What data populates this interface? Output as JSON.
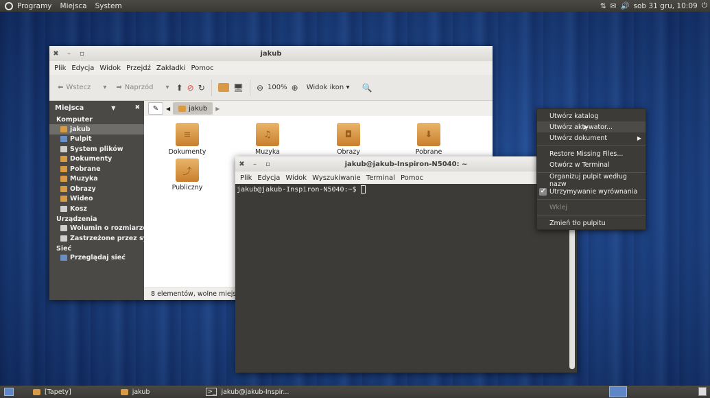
{
  "top_panel": {
    "menus": [
      "Programy",
      "Miejsca",
      "System"
    ],
    "clock": "sob 31 gru, 10:09"
  },
  "file_manager": {
    "title": "jakub",
    "menu": [
      "Plik",
      "Edycja",
      "Widok",
      "Przejdź",
      "Zakładki",
      "Pomoc"
    ],
    "toolbar": {
      "back_label": "Wstecz",
      "forward_label": "Naprzód",
      "zoom": "100%",
      "view_label": "Widok ikon"
    },
    "sidebar": {
      "title": "Miejsca",
      "sections": [
        {
          "heading": "Komputer",
          "items": [
            "jakub",
            "Pulpit",
            "System plików",
            "Dokumenty",
            "Pobrane",
            "Muzyka",
            "Obrazy",
            "Wideo",
            "Kosz"
          ]
        },
        {
          "heading": "Urządzenia",
          "items": [
            "Wolumin o rozmiarze ...",
            "Zastrzeżone przez sys..."
          ]
        },
        {
          "heading": "Sieć",
          "items": [
            "Przeglądaj sieć"
          ]
        }
      ]
    },
    "path_crumb": "jakub",
    "files": [
      "Dokumenty",
      "Muzyka",
      "Obrazy",
      "Pobrane",
      "Publiczny"
    ],
    "status": "8 elementów, wolne miejsce:"
  },
  "terminal": {
    "title": "jakub@jakub-Inspiron-N5040: ~",
    "menu": [
      "Plik",
      "Edycja",
      "Widok",
      "Wyszukiwanie",
      "Terminal",
      "Pomoc"
    ],
    "prompt": "jakub@jakub-Inspiron-N5040:~$ "
  },
  "context_menu": {
    "items": [
      "Utwórz katalog",
      "Utwórz aktywator...",
      "Utwórz dokument",
      "Restore Missing Files...",
      "Otwórz w Terminal",
      "Organizuj pulpit według nazw",
      "Utrzymywanie wyrównania",
      "Wklej",
      "Zmień tło pulpitu"
    ]
  },
  "bottom_panel": {
    "tasks": [
      "[Tapety]",
      "jakub",
      "jakub@jakub-Inspir..."
    ]
  }
}
